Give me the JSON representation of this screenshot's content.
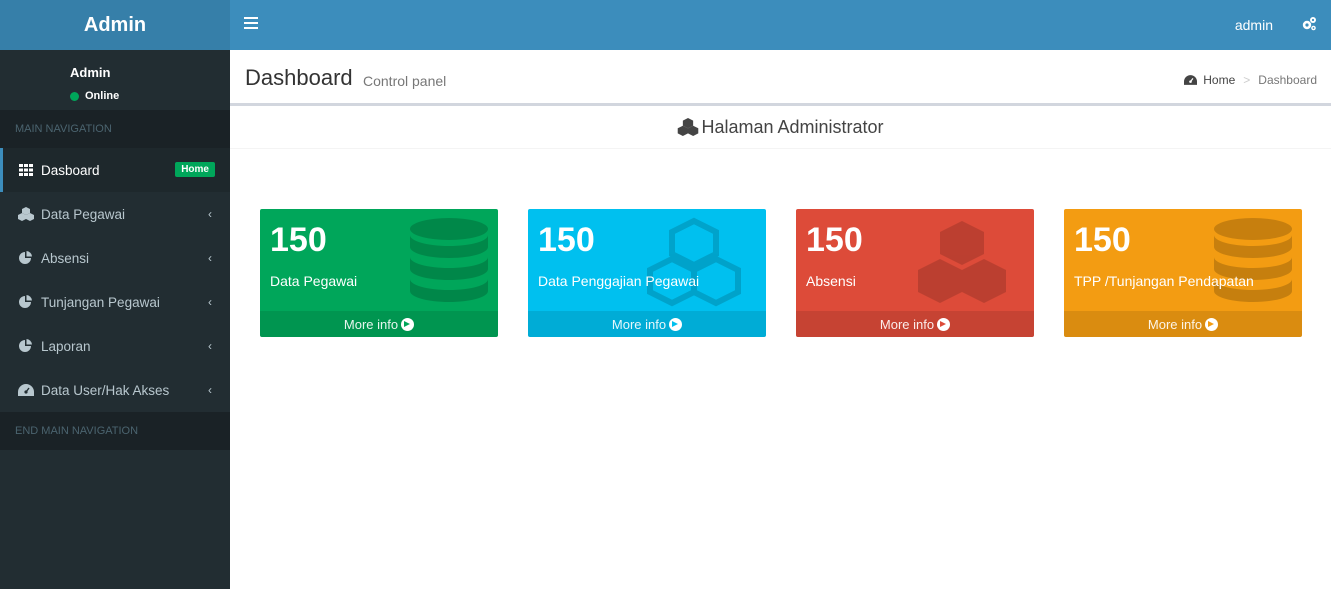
{
  "brand": {
    "logo_text": "Admin"
  },
  "user_panel": {
    "name": "Admin",
    "status": "Online"
  },
  "sidebar": {
    "header_top": "MAIN NAVIGATION",
    "header_bottom": "END MAIN NAVIGATION",
    "items": [
      {
        "label": "Dasboard",
        "icon": "grid-icon",
        "badge": "Home",
        "active": true
      },
      {
        "label": "Data Pegawai",
        "icon": "cubes-icon"
      },
      {
        "label": "Absensi",
        "icon": "pie-chart-icon"
      },
      {
        "label": "Tunjangan Pegawai",
        "icon": "pie-chart-icon"
      },
      {
        "label": "Laporan",
        "icon": "pie-chart-icon"
      },
      {
        "label": "Data User/Hak Akses",
        "icon": "dashboard-icon"
      }
    ]
  },
  "topbar": {
    "user": "admin",
    "menu_icon": "hamburger-icon",
    "settings_icon": "gears-icon"
  },
  "content_header": {
    "title": "Dashboard",
    "subtitle": "Control panel",
    "breadcrumb": {
      "home": "Home",
      "separator": ">",
      "current": "Dashboard"
    }
  },
  "box": {
    "title": "Halaman Administrator",
    "icon": "cubes-icon"
  },
  "tiles": [
    {
      "number": "150",
      "label": "Data Pegawai",
      "footer": "More info",
      "color": "#00a65a",
      "icon": "database-icon"
    },
    {
      "number": "150",
      "label": "Data Penggajian Pegawai",
      "footer": "More info",
      "color": "#00c0ef",
      "icon": "cubes-icon"
    },
    {
      "number": "150",
      "label": "Absensi",
      "footer": "More info",
      "color": "#dd4b39",
      "icon": "cubes-icon"
    },
    {
      "number": "150",
      "label": "TPP /Tunjangan Pendapatan",
      "footer": "More info",
      "color": "#f39c12",
      "icon": "database-icon"
    }
  ],
  "colors": {
    "sidebar": "#222d32",
    "header": "#3c8dbc",
    "logo": "#367fa9"
  }
}
